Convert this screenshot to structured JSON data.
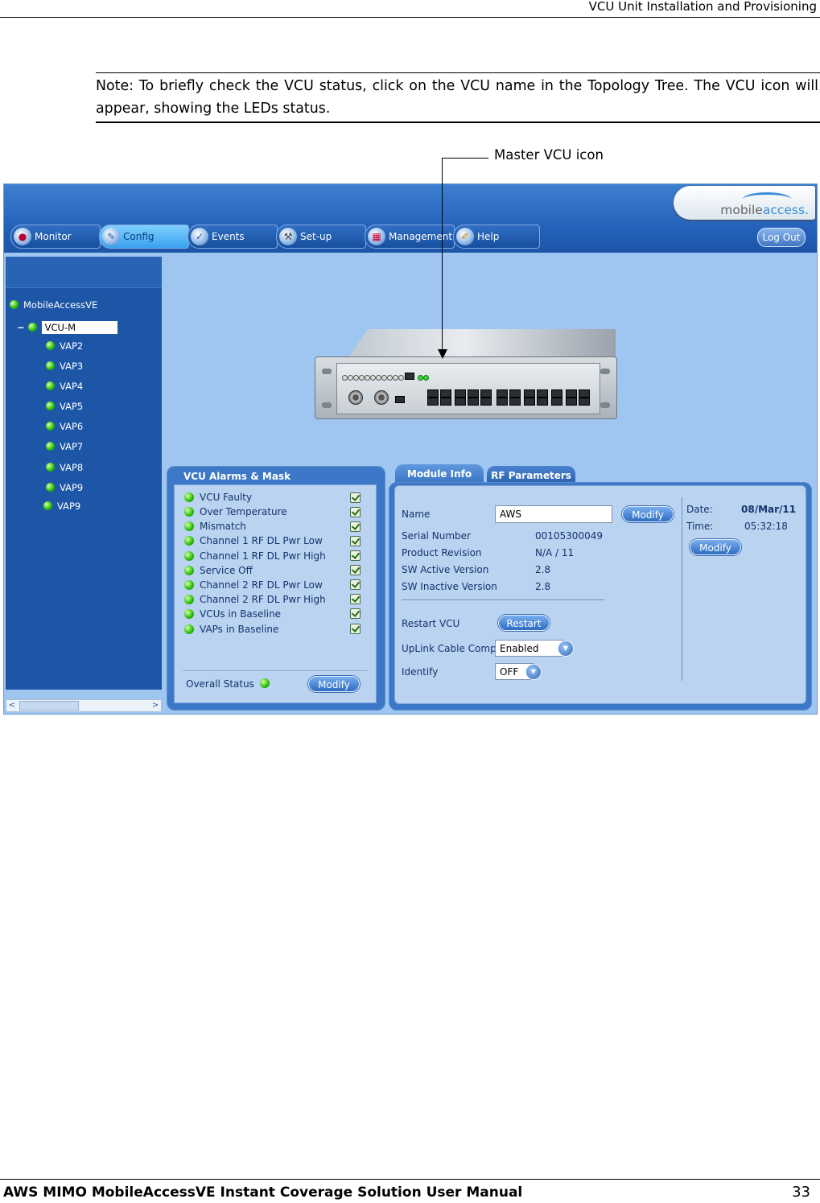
{
  "page": {
    "header": "VCU Unit Installation and Provisioning",
    "note": "Note: To briefly check the VCU status, click on the VCU name in the Topology Tree. The VCU icon will appear, showing the LEDs status.",
    "callout": "Master VCU icon",
    "footer": "AWS MIMO MobileAccessVE Instant Coverage Solution User Manual",
    "page_number": "33"
  },
  "app": {
    "logo_a": "mobile",
    "logo_b": "access.",
    "tabs": [
      {
        "label": "Monitor",
        "icon": "monitor-icon"
      },
      {
        "label": "Config",
        "icon": "wrench-icon"
      },
      {
        "label": "Events",
        "icon": "events-icon"
      },
      {
        "label": "Set-up",
        "icon": "setup-icon"
      },
      {
        "label": "Management",
        "icon": "management-icon"
      },
      {
        "label": "Help",
        "icon": "help-icon"
      }
    ],
    "logout": "Log Out",
    "tree": {
      "root": "MobileAccessVE",
      "selected": "VCU-M",
      "children": [
        "VAP2",
        "VAP3",
        "VAP4",
        "VAP5",
        "VAP6",
        "VAP7",
        "VAP8",
        "VAP9",
        "VAP9"
      ]
    },
    "alarms": {
      "title": "VCU Alarms & Mask",
      "items": [
        "VCU Faulty",
        "Over Temperature",
        "Mismatch",
        "Channel 1 RF DL Pwr Low",
        "Channel 1 RF DL Pwr High",
        "Service Off",
        "Channel 2 RF DL Pwr Low",
        "Channel 2 RF DL Pwr High",
        "VCUs in Baseline",
        "VAPs in Baseline"
      ],
      "overall_label": "Overall Status",
      "modify": "Modify"
    },
    "module": {
      "tab_active": "Module Info",
      "tab_other": "RF Parameters",
      "name_label": "Name",
      "name_value": "AWS",
      "modify": "Modify",
      "serial_label": "Serial Number",
      "serial_value": "00105300049",
      "revision_label": "Product Revision",
      "revision_value": "N/A / 11",
      "sw_active_label": "SW Active Version",
      "sw_active_value": "2.8",
      "sw_inactive_label": "SW Inactive Version",
      "sw_inactive_value": "2.8",
      "restart_label": "Restart VCU",
      "restart_button": "Restart",
      "uplink_label": "UpLink Cable Comp.",
      "uplink_value": "Enabled",
      "identify_label": "Identify",
      "identify_value": "OFF",
      "date_label": "Date:",
      "date_value": "08/Mar/11",
      "time_label": "Time:",
      "time_value": "05:32:18",
      "datetime_modify": "Modify"
    }
  }
}
